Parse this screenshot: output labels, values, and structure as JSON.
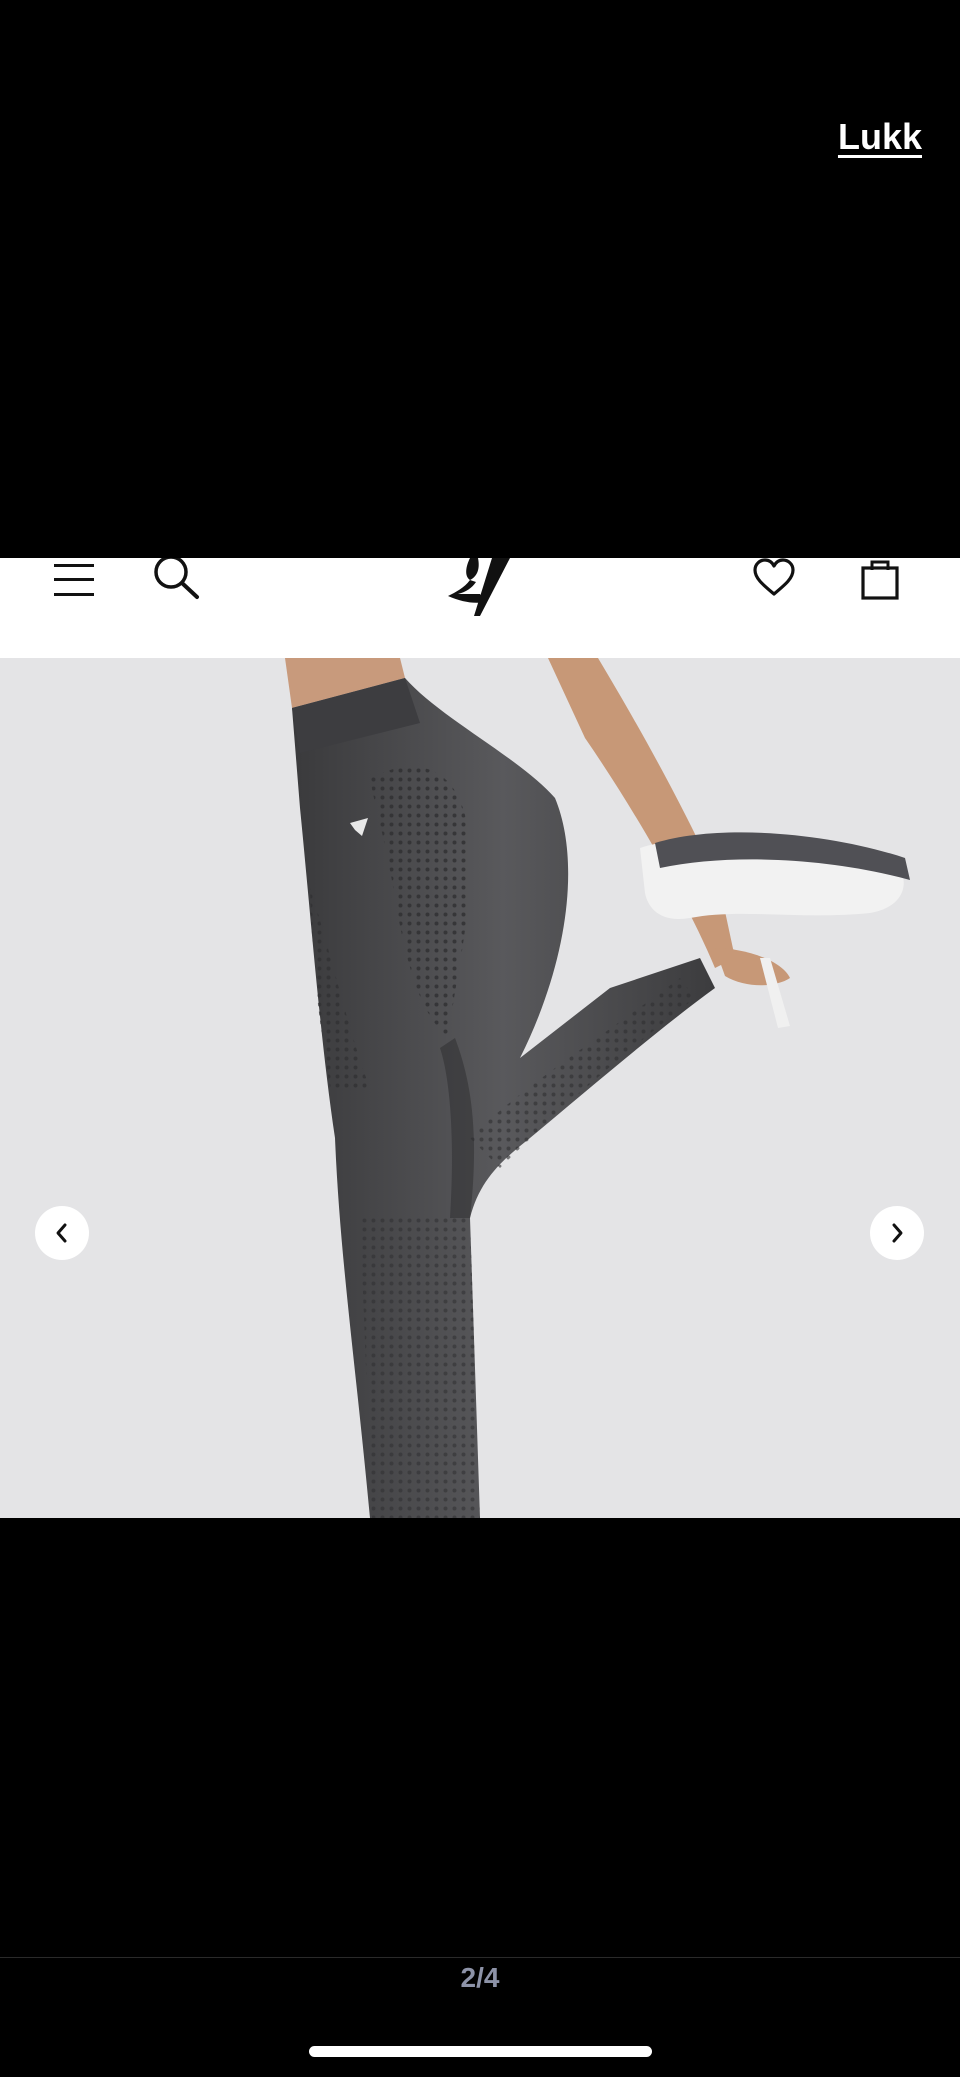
{
  "viewer": {
    "close_label": "Lukk",
    "counter": "2/4"
  },
  "header_icons": [
    "menu-icon",
    "search-icon",
    "logo-icon",
    "heart-icon",
    "bag-icon"
  ],
  "carousel": {
    "prev_icon": "chevron-left-icon",
    "next_icon": "chevron-right-icon"
  },
  "colors": {
    "background": "#000000",
    "image_background": "#e4e4e6",
    "counter_text": "#8d93a8",
    "header_background": "#ffffff"
  }
}
